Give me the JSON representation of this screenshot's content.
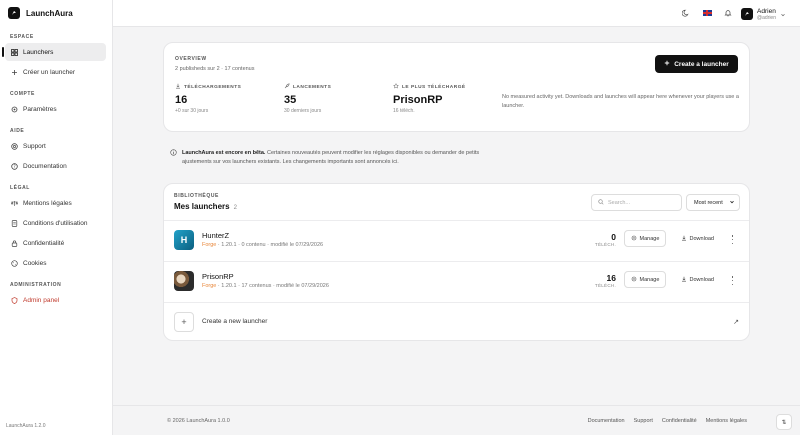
{
  "app": {
    "name": "LaunchAura",
    "version": "LaunchAura 1.2.0"
  },
  "sidebar": {
    "sections": [
      {
        "label": "Espace"
      },
      {
        "label": "Compte"
      },
      {
        "label": "Aide"
      },
      {
        "label": "Légal"
      },
      {
        "label": "Administration"
      }
    ],
    "items": [
      {
        "label": "Launchers",
        "icon": "grid-icon"
      },
      {
        "label": "Créer un launcher",
        "icon": "plus-icon"
      },
      {
        "label": "Paramètres",
        "icon": "gear-icon"
      },
      {
        "label": "Support",
        "icon": "help-circle-icon"
      },
      {
        "label": "Documentation",
        "icon": "question-icon"
      },
      {
        "label": "Mentions légales",
        "icon": "scale-icon"
      },
      {
        "label": "Conditions d'utilisation",
        "icon": "document-icon"
      },
      {
        "label": "Confidentialité",
        "icon": "lock-icon"
      },
      {
        "label": "Cookies",
        "icon": "cookie-icon"
      },
      {
        "label": "Admin panel",
        "icon": "shield-icon"
      }
    ]
  },
  "topbar": {
    "user": {
      "name": "Adrien",
      "handle": "@adrien"
    }
  },
  "overview": {
    "label": "OVERVIEW",
    "subtitle": "2 publisheds sur 2 · 17 contenus",
    "create_button": "Create a launcher",
    "stats": [
      {
        "label": "TÉLÉCHARGEMENTS",
        "value": "16",
        "note": "+0 sur 30 jours"
      },
      {
        "label": "LANCEMENTS",
        "value": "35",
        "note": "30 derniers jours"
      },
      {
        "label": "LE PLUS TÉLÉCHARGÉ",
        "value": "PrisonRP",
        "note": "16 téléch."
      }
    ],
    "empty_message": "No measured activity yet. Downloads and launches will appear here whenever your players use a launcher."
  },
  "beta": {
    "title": "LaunchAura est encore en bêta.",
    "text": " Certaines nouveautés peuvent modifier les réglages disponibles ou demander de petits ajustements sur vos launchers existants. Les changements importants sont annoncés ici."
  },
  "library": {
    "label": "BIBLIOTHÈQUE",
    "title": "Mes launchers",
    "count": "2",
    "search_placeholder": "Search...",
    "sort_selected": "Most recent",
    "rows": [
      {
        "name": "HunterZ",
        "loader": "Forge",
        "meta": " · 1.20.1 · 0 contenu · modifié le 07/29/2026",
        "downloads": "0",
        "downloads_label": "TÉLÉCH.",
        "manage": "Manage",
        "download": "Download"
      },
      {
        "name": "PrisonRP",
        "loader": "Forge",
        "meta": " · 1.20.1 · 17 contenus · modifié le 07/29/2026",
        "downloads": "16",
        "downloads_label": "TÉLÉCH.",
        "manage": "Manage",
        "download": "Download"
      }
    ],
    "new_launcher": "Create a new launcher"
  },
  "footer": {
    "copyright": "© 2026 LaunchAura 1.0.0",
    "links": [
      "Documentation",
      "Support",
      "Confidentialité",
      "Mentions légales"
    ]
  }
}
